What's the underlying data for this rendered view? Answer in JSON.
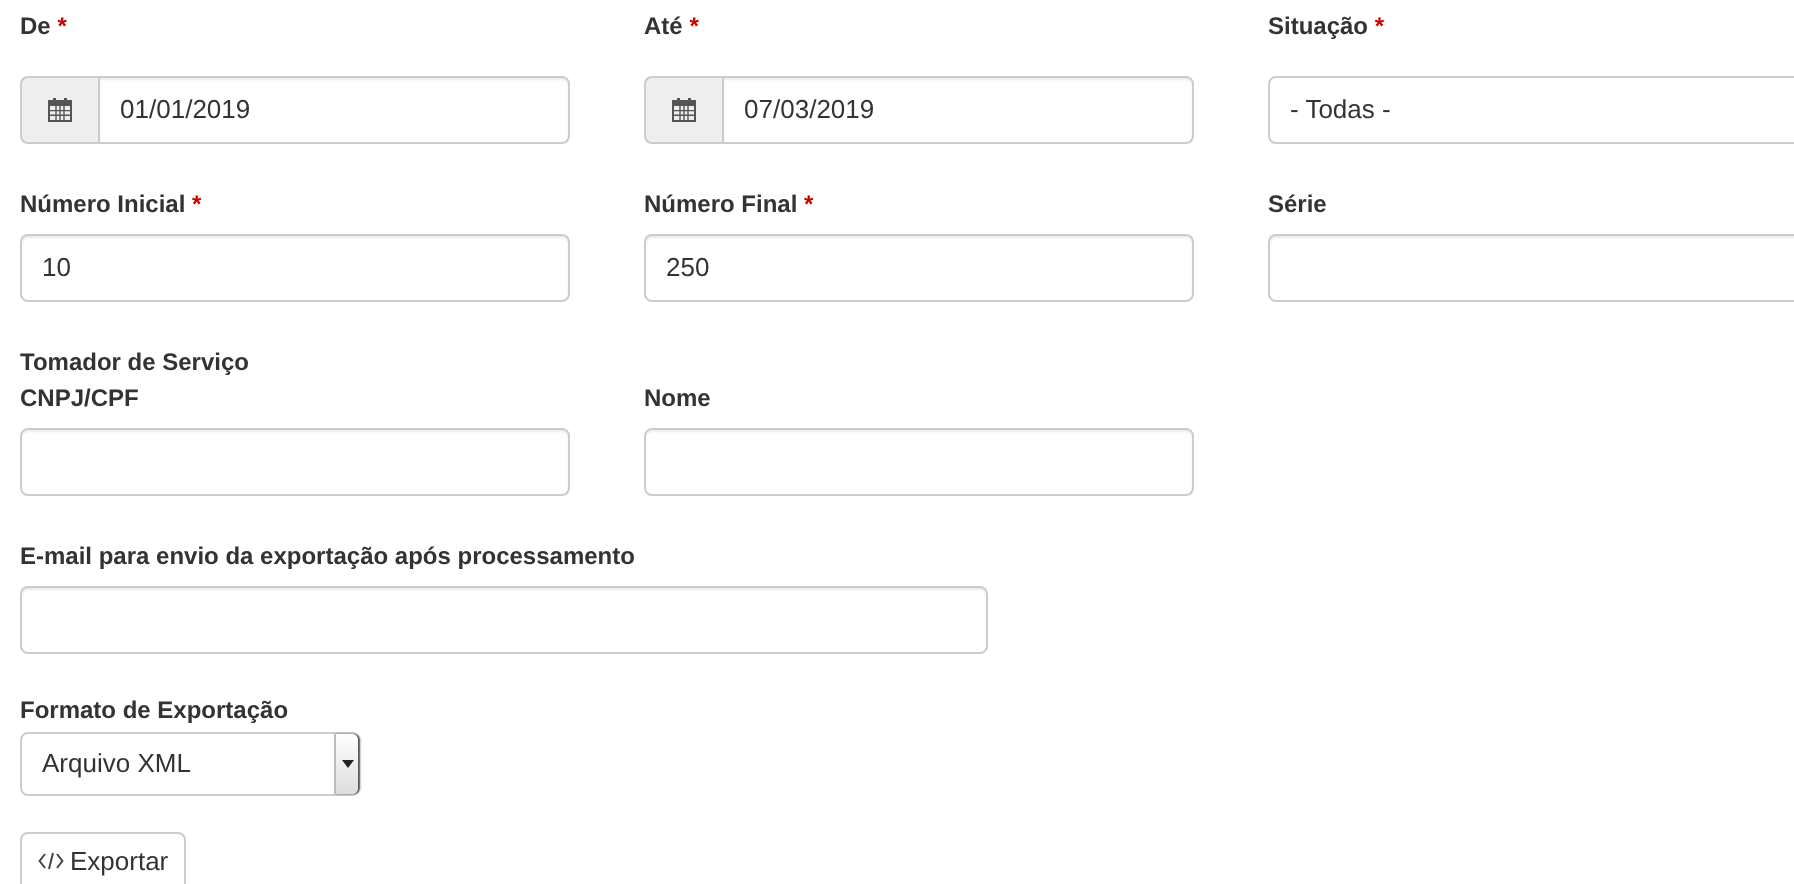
{
  "rows": [
    {
      "fields": [
        {
          "label": "De",
          "required_mark": "*",
          "kind": "date",
          "value": "01/01/2019"
        },
        {
          "label": "Até",
          "required_mark": "*",
          "kind": "date",
          "value": "07/03/2019"
        },
        {
          "label": "Situação",
          "required_mark": "*",
          "kind": "select",
          "value": "- Todas -"
        }
      ]
    },
    {
      "fields": [
        {
          "label": "Número Inicial",
          "required_mark": "*",
          "kind": "text",
          "value": "10"
        },
        {
          "label": "Número Final",
          "required_mark": "*",
          "kind": "text",
          "value": "250"
        },
        {
          "label": "Série",
          "kind": "text"
        }
      ]
    },
    {
      "heading": "Tomador de Serviço",
      "fields": [
        {
          "label": "CNPJ/CPF",
          "kind": "text"
        },
        {
          "label": "Nome",
          "kind": "text"
        }
      ]
    }
  ],
  "email_field": {
    "label": "E-mail para envio da exportação após processamento",
    "kind": "text"
  },
  "export_format": {
    "label": "Formato de Exportação",
    "kind": "select",
    "value": "Arquivo XML"
  },
  "export_button": {
    "label": "Exportar"
  }
}
